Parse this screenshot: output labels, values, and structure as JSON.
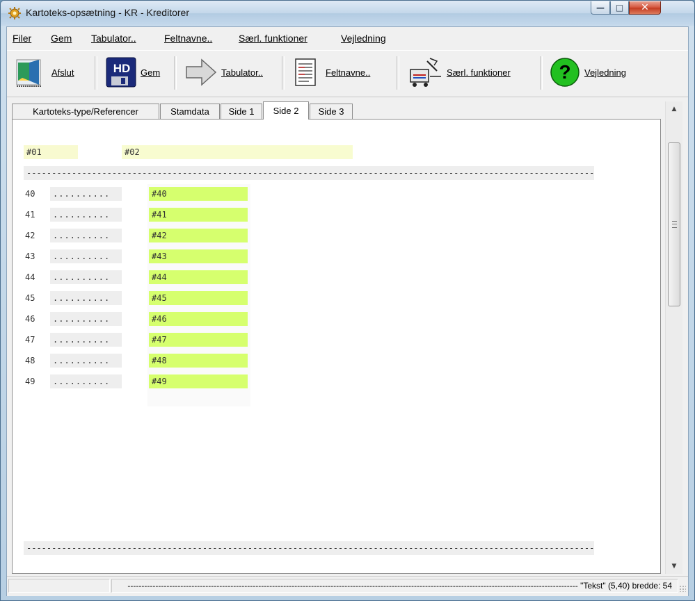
{
  "window": {
    "title": "Kartoteks-opsætning - KR - Kreditorer",
    "controls": {
      "minimize": "—",
      "maximize": "□",
      "close": "✕"
    }
  },
  "menu": {
    "items": [
      {
        "label": "Filer"
      },
      {
        "label": "Gem"
      },
      {
        "label": "Tabulator.."
      },
      {
        "label": "Feltnavne.."
      },
      {
        "label": "Særl. funktioner"
      },
      {
        "label": "Vejledning"
      }
    ]
  },
  "toolbar": {
    "buttons": [
      {
        "label": "Afslut",
        "icon": "exit-door-icon"
      },
      {
        "label": "Gem",
        "icon": "floppy-disk-icon"
      },
      {
        "label": "Tabulator..",
        "icon": "arrow-right-icon"
      },
      {
        "label": "Feltnavne..",
        "icon": "document-list-icon"
      },
      {
        "label": "Særl. funktioner",
        "icon": "tools-icon"
      },
      {
        "label": "Vejledning",
        "icon": "help-icon"
      }
    ],
    "floppy_text": "HD"
  },
  "tabs": [
    {
      "label": "Kartoteks-type/Referencer",
      "active": false
    },
    {
      "label": "Stamdata",
      "active": false
    },
    {
      "label": "Side 1",
      "active": false
    },
    {
      "label": "Side 2",
      "active": true
    },
    {
      "label": "Side 3",
      "active": false
    }
  ],
  "content": {
    "header_fields": [
      "#01",
      "#02"
    ],
    "separator": "------------------------------------------------------------------------------------------------------------------------------------------------",
    "rows": [
      {
        "num": "40",
        "dots": "..........",
        "field": "#40"
      },
      {
        "num": "41",
        "dots": "..........",
        "field": "#41"
      },
      {
        "num": "42",
        "dots": "..........",
        "field": "#42"
      },
      {
        "num": "43",
        "dots": "..........",
        "field": "#43"
      },
      {
        "num": "44",
        "dots": "..........",
        "field": "#44"
      },
      {
        "num": "45",
        "dots": "..........",
        "field": "#45"
      },
      {
        "num": "46",
        "dots": "..........",
        "field": "#46"
      },
      {
        "num": "47",
        "dots": "..........",
        "field": "#47"
      },
      {
        "num": "48",
        "dots": "..........",
        "field": "#48"
      },
      {
        "num": "49",
        "dots": "..........",
        "field": "#49"
      }
    ]
  },
  "status": {
    "text": "------------------------------------------------------------------------------------------------------------------------------------------------------------------ \"Tekst\" (5,40) bredde: 54"
  },
  "colors": {
    "field_green": "#d6ff6e",
    "header_yellow": "#f8fad0",
    "separator_gray": "#eeeeee"
  }
}
